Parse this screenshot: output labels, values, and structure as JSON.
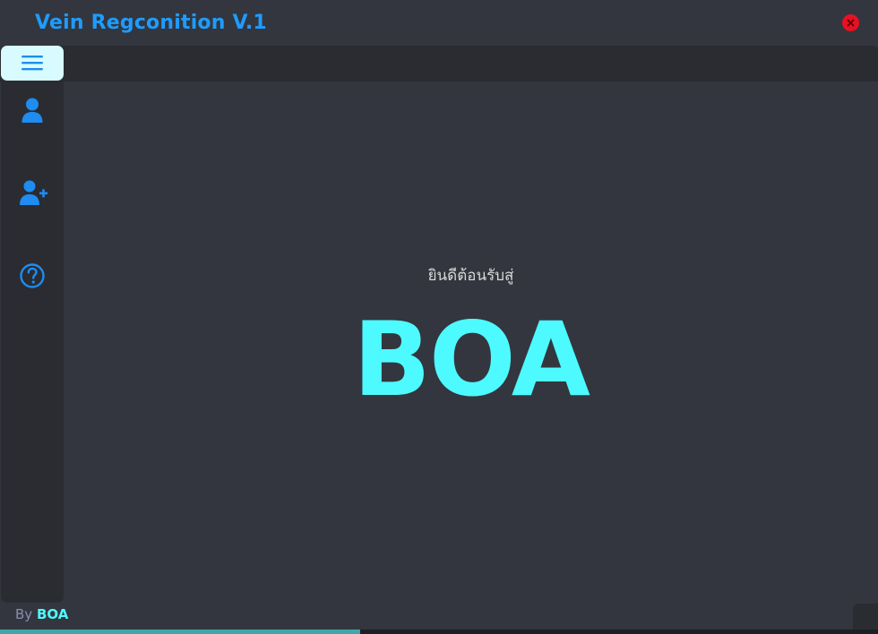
{
  "window": {
    "title": "Vein Regconition V.1",
    "close_icon": "close-x-icon"
  },
  "sidebar": {
    "menu_icon": "hamburger-menu-icon",
    "items": [
      {
        "icon": "user-icon",
        "label": "User"
      },
      {
        "icon": "add-user-icon",
        "label": "Add user"
      },
      {
        "icon": "help-question-icon",
        "label": "Help"
      }
    ]
  },
  "main": {
    "welcome_text": "ยินดีต้อนรับสู่",
    "brand_text": "BOA"
  },
  "footer": {
    "by_label": "By",
    "by_name": "BOA"
  },
  "taskbar": {
    "progress_fraction": 0.41
  },
  "colors": {
    "title": "#1e9cff",
    "accent_cyan": "#4dfaff",
    "background": "#33363e",
    "panel": "#2a2c32",
    "icon_blue": "#1e8cf0",
    "close_red": "#e81123",
    "menu_button_bg": "#d8fbff"
  }
}
